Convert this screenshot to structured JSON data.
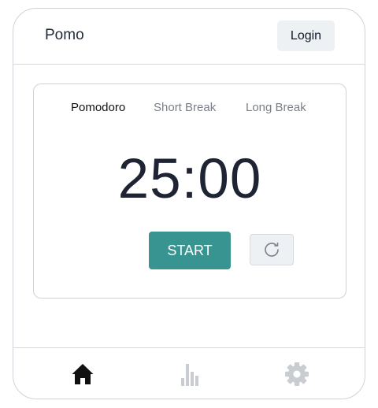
{
  "header": {
    "title": "Pomo",
    "login_label": "Login"
  },
  "timer": {
    "tabs": [
      {
        "label": "Pomodoro",
        "active": true
      },
      {
        "label": "Short Break",
        "active": false
      },
      {
        "label": "Long Break",
        "active": false
      }
    ],
    "display": "25:00",
    "start_label": "START",
    "reset_icon": "refresh-icon"
  },
  "bottom_nav": {
    "items": [
      {
        "icon": "home-icon",
        "active": true
      },
      {
        "icon": "bar-chart-icon",
        "active": false
      },
      {
        "icon": "gear-icon",
        "active": false
      }
    ]
  },
  "colors": {
    "accent": "#379490",
    "text_dark": "#1e2433",
    "muted": "#7b8088",
    "inactive_icon": "#c9cdd2"
  }
}
